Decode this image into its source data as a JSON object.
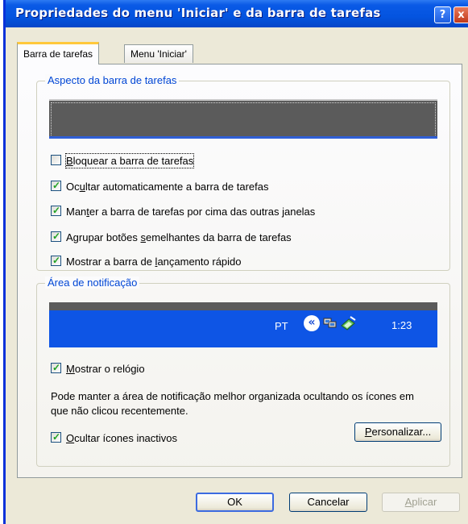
{
  "window": {
    "title": "Propriedades do menu 'Iniciar' e da barra de tarefas",
    "help_label": "?",
    "close_label": "x"
  },
  "tabs": [
    {
      "label": "Barra de tarefas",
      "active": true
    },
    {
      "label": "Menu 'Iniciar'",
      "active": false
    }
  ],
  "appearance": {
    "group_label": "Aspecto da barra de tarefas",
    "options": [
      {
        "pre": "",
        "key": "B",
        "post": "loquear a barra de tarefas",
        "checked": false
      },
      {
        "pre": "Oc",
        "key": "u",
        "post": "ltar automaticamente a barra de tarefas",
        "checked": true
      },
      {
        "pre": "Man",
        "key": "t",
        "post": "er a barra de tarefas por cima das outras janelas",
        "checked": true
      },
      {
        "pre": "Agrupar botões ",
        "key": "s",
        "post": "emelhantes da barra de tarefas",
        "checked": true
      },
      {
        "pre": "Mostrar a barra de ",
        "key": "l",
        "post": "ançamento rápido",
        "checked": true
      }
    ]
  },
  "notification": {
    "group_label": "Área de notificação",
    "tray": {
      "language": "PT",
      "chevron": "«",
      "time": "1:23"
    },
    "show_clock": {
      "pre": "",
      "key": "M",
      "post": "ostrar o relógio",
      "checked": true
    },
    "description": "Pode manter a área de notificação melhor organizada ocultando os ícones em que não clicou recentemente.",
    "hide_inactive": {
      "pre": "",
      "key": "O",
      "post": "cultar ícones inactivos",
      "checked": true
    },
    "customize": {
      "pre": "",
      "key": "P",
      "post": "ersonalizar..."
    }
  },
  "buttons": {
    "ok": "OK",
    "cancel": "Cancelar",
    "apply": {
      "pre": "",
      "key": "A",
      "post": "plicar",
      "enabled": false
    }
  },
  "colors": {
    "title_bar": "#0454e0",
    "group_label": "#0046d5",
    "tab_highlight": "#ffc83c",
    "taskbar_blue": "#0e55e5",
    "check_green": "#21a121"
  }
}
